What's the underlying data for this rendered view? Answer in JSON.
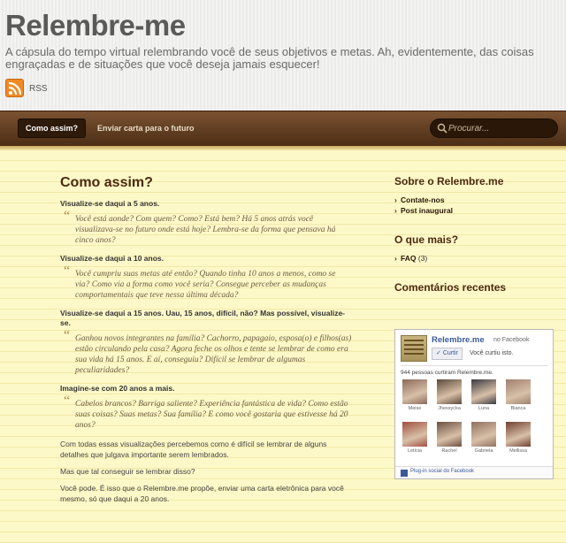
{
  "site": {
    "title": "Relembre-me",
    "description": "A cápsula do tempo virtual relembrando você de seus objetivos e metas. Ah, evidentemente, das coisas engraçadas e de situações que você deseja jamais esquecer!",
    "rss_label": "RSS"
  },
  "nav": {
    "items": [
      "Como assim?",
      "Enviar carta para o futuro"
    ],
    "search_placeholder": "Procurar..."
  },
  "post": {
    "title": "Como assim?",
    "blocks": [
      {
        "type": "head",
        "text": "Visualize-se daqui a 5 anos."
      },
      {
        "type": "quote",
        "text": "Você está aonde? Com quem? Como? Está bem? Há 5 anos atrás você visualizava-se no futuro onde está hoje? Lembra-se da forma que pensava há cinco anos?"
      },
      {
        "type": "head",
        "text": "Visualize-se daqui a 10 anos."
      },
      {
        "type": "quote",
        "text": "Você cumpriu suas metas até então? Quando tinha 10 anos a menos, como se via? Como via a forma como você seria? Consegue perceber as mudanças comportamentais que teve nessa última década?"
      },
      {
        "type": "head",
        "text": "Visualize-se daqui a 15 anos. Uau, 15 anos, difícil, não? Mas possível, visualize-se."
      },
      {
        "type": "quote",
        "text": "Ganhou novos integrantes na família? Cachorro, papagaio, esposa(o) e filhos(as) estão circulando pela casa? Agora feche os olhos e tente se lembrar de como era sua vida há 15 anos. E aí, conseguiu? Difícil se lembrar de algumas peculiaridades?"
      },
      {
        "type": "head",
        "text": "Imagine-se com 20 anos a mais."
      },
      {
        "type": "quote",
        "text": "Cabelos brancos? Barriga saliente? Experiência fantástica de vida? Como estão suas coisas? Suas metas? Sua família? E como você gostaria que estivesse há 20 anos?"
      },
      {
        "type": "para",
        "text": "Com todas essas visualizações percebemos como é difícil se lembrar de alguns detalhes que julgava importante serem lembrados."
      },
      {
        "type": "para",
        "text": "Mas que tal conseguir se lembrar disso?"
      },
      {
        "type": "para",
        "text": "Você pode. É isso que o Relembre.me propõe, enviar uma carta eletrônica para você mesmo, só que daqui a 20 anos."
      }
    ]
  },
  "sidebar": {
    "about_title": "Sobre o Relembre.me",
    "about_links": [
      "Contate-nos",
      "Post inaugural"
    ],
    "more_title": "O que mais?",
    "more_items": [
      {
        "label": "FAQ",
        "count": "(3)"
      }
    ],
    "comments_title": "Comentários recentes"
  },
  "facebook": {
    "page_name": "Relembre.me",
    "on_label": "no Facebook",
    "like_label": "Curtir",
    "like_note": "Você curtiu isto.",
    "count_text": "944 pessoas curtiram Relembre.me.",
    "faces": [
      "Meise",
      "Jhessycka",
      "Luna",
      "Bianca",
      "Letícia",
      "Rachel",
      "Gabriela",
      "Mellissa"
    ],
    "footer": "Plug-in social do Facebook"
  }
}
